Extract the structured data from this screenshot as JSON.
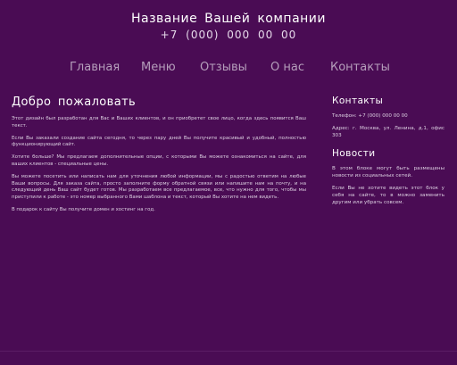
{
  "header": {
    "company_name": "Название Вашей компании",
    "phone": "+7 (000) 000 00 00"
  },
  "nav": {
    "items": [
      {
        "label": "Главная"
      },
      {
        "label": "Меню"
      },
      {
        "label": "Отзывы"
      },
      {
        "label": "О нас"
      },
      {
        "label": "Контакты"
      }
    ]
  },
  "main": {
    "title": "Добро пожаловать",
    "paragraphs": [
      "Этот дизайн был разработан для Вас и Ваших клиентов, и он приобретет свое лицо, когда здесь появится Ваш текст.",
      "Если Вы заказали создание сайта сегодня, то через пару дней Вы получите красивый и удобный, полностью функционирующий сайт.",
      "Хотите больше? Мы предлагаем дополнительные опции, с которыми Вы можете ознакомиться на сайте, для ваших клиентов - специальные цены.",
      "Вы можете посетить или написать нам для уточнения любой информации, мы с радостью ответим на любые Ваши вопросы. Для заказа сайта, просто заполните форму обратной связи или напишите нам на почту, и на следующий день Ваш сайт будет готов. Мы разработаем все предлагаемое, все, что нужно для того, чтобы мы приступили к работе - это номер выбранного Вами шаблона и текст, который Вы хотите на нем видеть.",
      "В подарок к сайту Вы получите домен и хостинг на год."
    ]
  },
  "sidebar": {
    "contacts_title": "Контакты",
    "phone_line": "Телефон: +7 (000) 000 00 00",
    "address_line": "Адрес: г. Москва, ул. Ленина, д.1, офис 303",
    "news_title": "Новости",
    "news_paragraphs": [
      "В этом блоке могут быть размещены новости из социальных сетей.",
      "Если Вы не хотите видеть этот блок у себя на сайте, то в можно заменить другим или убрать совсем."
    ]
  }
}
